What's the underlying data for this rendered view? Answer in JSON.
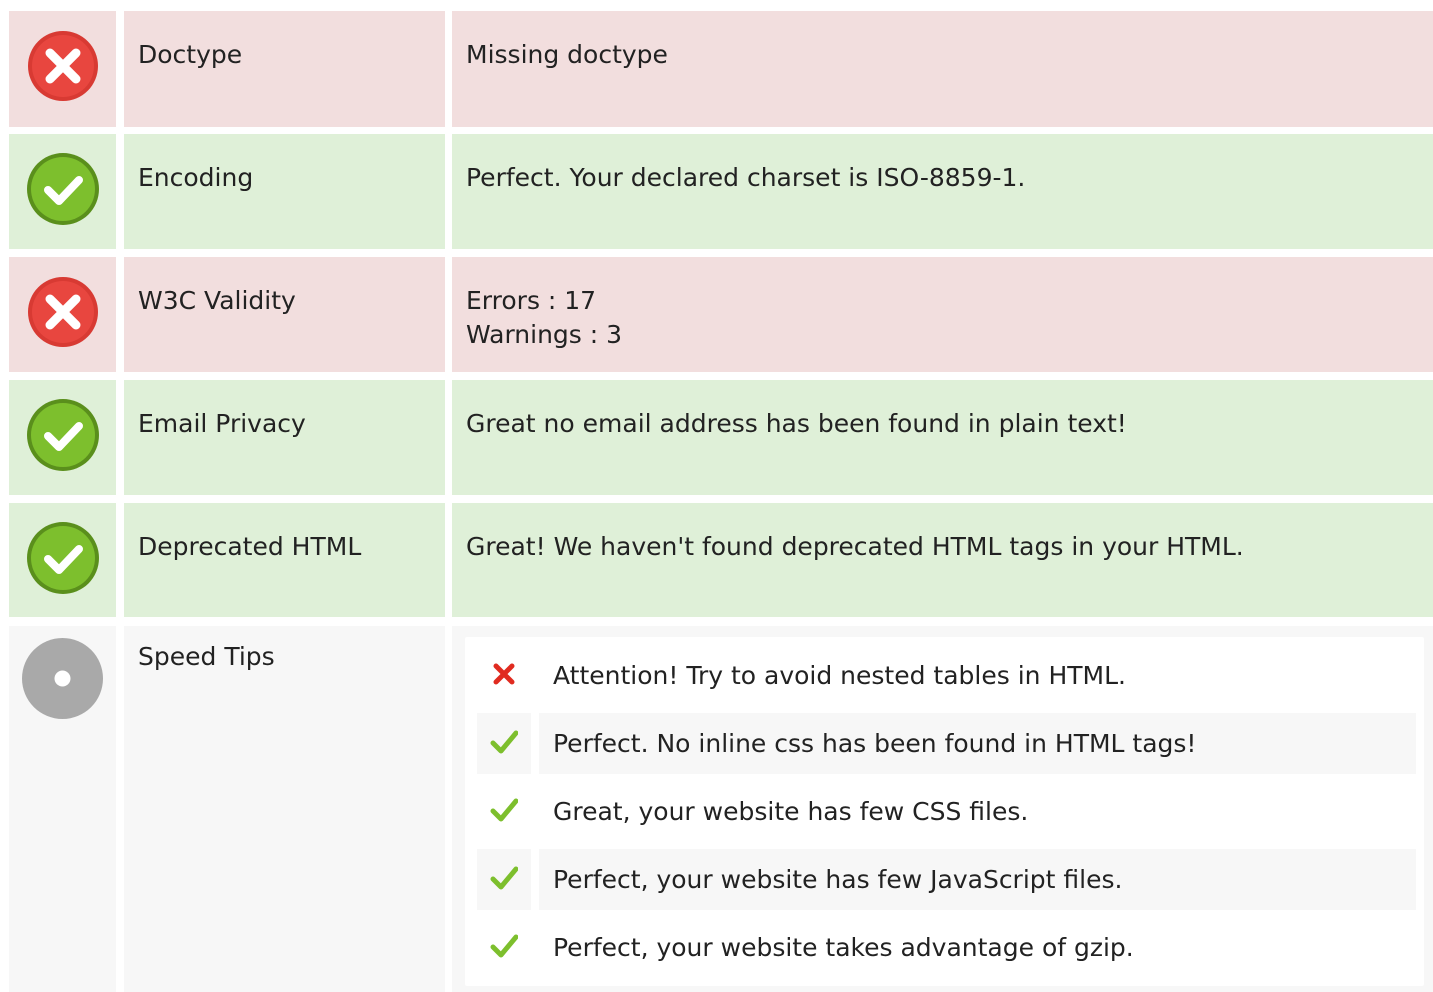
{
  "colors": {
    "bad_bg": "#f2dede",
    "good_bg": "#dff0d8",
    "neutral_bg": "#f7f7f7",
    "error_red": "#e8463f",
    "success_green": "#7dbf2d",
    "neutral_gray": "#a9a9a9"
  },
  "checks": [
    {
      "status": "error",
      "icon": "error-icon",
      "label": "Doctype",
      "value": [
        "Missing doctype"
      ]
    },
    {
      "status": "success",
      "icon": "check-icon",
      "label": "Encoding",
      "value": [
        "Perfect. Your declared charset is ISO-8859-1."
      ]
    },
    {
      "status": "error",
      "icon": "error-icon",
      "label": "W3C Validity",
      "value": [
        "Errors : 17",
        "Warnings : 3"
      ]
    },
    {
      "status": "success",
      "icon": "check-icon",
      "label": "Email Privacy",
      "value": [
        "Great no email address has been found in plain text!"
      ]
    },
    {
      "status": "success",
      "icon": "check-icon",
      "label": "Deprecated HTML",
      "value": [
        "Great! We haven't found deprecated HTML tags in your HTML."
      ]
    }
  ],
  "speed_tips": {
    "status": "neutral",
    "icon": "info-icon",
    "label": "Speed Tips",
    "items": [
      {
        "status": "fail",
        "icon": "cross-icon",
        "text": "Attention! Try to avoid nested tables in HTML."
      },
      {
        "status": "pass",
        "icon": "checkmark-icon",
        "text": "Perfect. No inline css has been found in HTML tags!"
      },
      {
        "status": "pass",
        "icon": "checkmark-icon",
        "text": "Great, your website has few CSS files."
      },
      {
        "status": "pass",
        "icon": "checkmark-icon",
        "text": "Perfect, your website has few JavaScript files."
      },
      {
        "status": "pass",
        "icon": "checkmark-icon",
        "text": "Perfect, your website takes advantage of gzip."
      }
    ]
  }
}
